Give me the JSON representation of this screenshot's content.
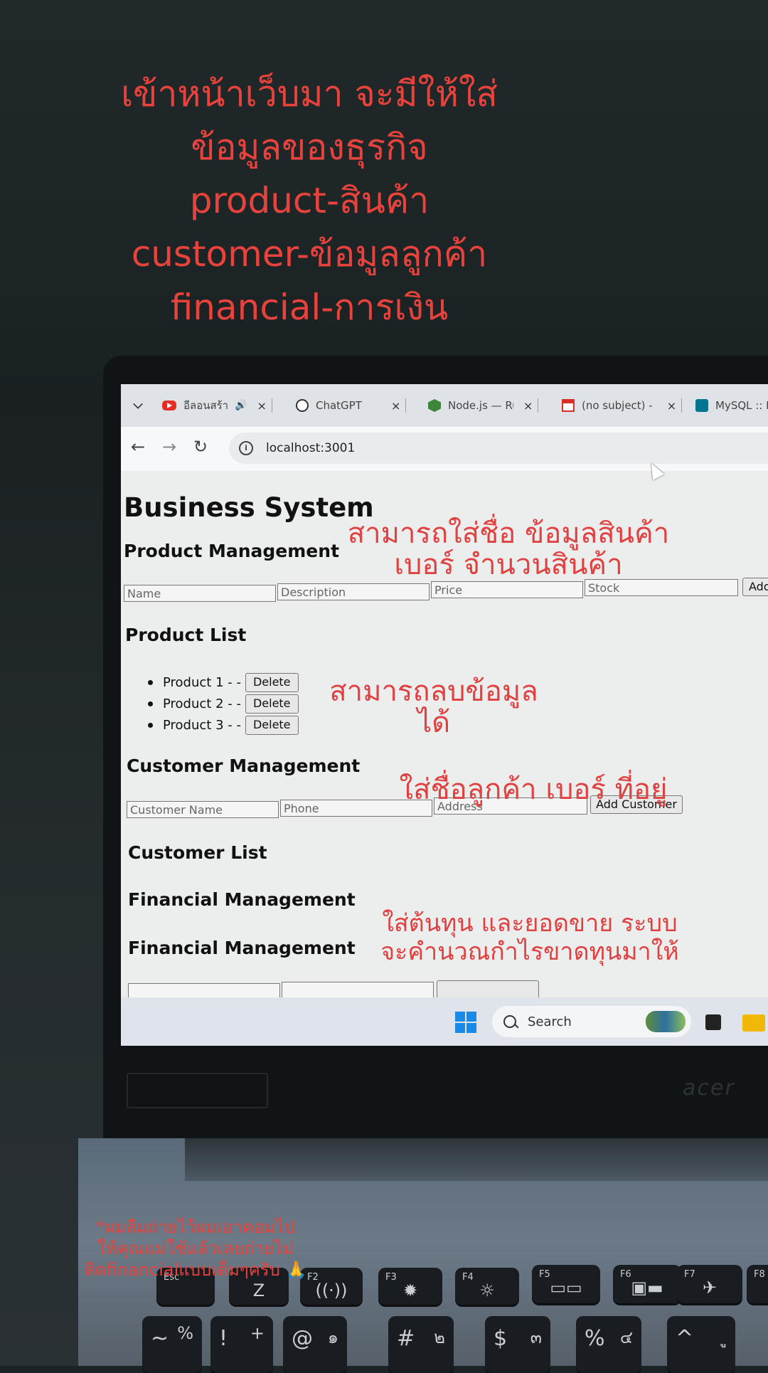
{
  "overlay": {
    "title_lines": [
      "เข้าหน้าเว็บมา จะมีให้ใส่",
      "ข้อมูลของธุรกิจ",
      "product-สินค้า",
      "customer-ข้อมูลลูกค้า",
      "financial-การเงิน"
    ],
    "note_product_line1": "สามารถใส่ชื่อ ข้อมูลสินค้า",
    "note_product_line2": "เบอร์ จำนวนสินค้า",
    "note_delete_line1": "สามารถลบข้อมูล",
    "note_delete_line2": "ได้",
    "note_customer": "ใส่ชื่อลูกค้า เบอร์ ที่อยู่",
    "note_financial_line1": "ใส่ต้นทุน และยอดขาย ระบบ",
    "note_financial_line2": "จะคำนวณกำไรขาดทุนมาให้",
    "footnote_line1": "*ผมลืมถ่ายไว้ผมเอาคอมไป",
    "footnote_line2": "ให้คุณแม่ใช้แล้วเลยถ่ายไม่",
    "footnote_line3": "ติดfinancialแบบเต็มๆครับ 🙏",
    "accent_color": "#e8423c"
  },
  "browser": {
    "tabs": [
      {
        "label": "อีลอนสร้าง",
        "favicon": "youtube-icon",
        "has_audio": true
      },
      {
        "label": "ChatGPT",
        "favicon": "chatgpt-icon"
      },
      {
        "label": "Node.js — Ru",
        "favicon": "nodejs-icon"
      },
      {
        "label": "(no subject) -",
        "favicon": "gmail-icon"
      },
      {
        "label": "MySQL :: B",
        "favicon": "mysql-icon"
      }
    ],
    "close_glyph": "×",
    "audio_glyph": "🔊",
    "url": "localhost:3001"
  },
  "page": {
    "title": "Business System",
    "product_section": "Product Management",
    "product_fields": [
      "Name",
      "Description",
      "Price",
      "Stock"
    ],
    "product_add_button": "Add",
    "product_list_title": "Product List",
    "products": [
      "Product 1 - -",
      "Product 2 - -",
      "Product 3 - -"
    ],
    "delete_label": "Delete",
    "customer_section": "Customer Management",
    "customer_fields": [
      "Customer Name",
      "Phone",
      "Address"
    ],
    "customer_add_button": "Add Customer",
    "customer_list_title": "Customer List",
    "financial_section_1": "Financial Management",
    "financial_section_2": "Financial Management"
  },
  "taskbar": {
    "search_label": "Search"
  },
  "laptop": {
    "brand": "acer",
    "keys": [
      {
        "label": "Esc"
      },
      {
        "label": "F2"
      },
      {
        "label": "F3"
      },
      {
        "label": "F4"
      },
      {
        "label": "F5"
      },
      {
        "label": "F6"
      },
      {
        "label": "F7"
      },
      {
        "label": "F8"
      }
    ],
    "number_keys": [
      {
        "top": "~",
        "side": "%"
      },
      {
        "top": "!",
        "side": "+"
      },
      {
        "top": "@",
        "side": "๑"
      },
      {
        "top": "#",
        "side": "๒"
      },
      {
        "top": "$",
        "side": "๓"
      },
      {
        "top": "%",
        "side": "๔"
      },
      {
        "top": "^",
        "side": "ู"
      }
    ]
  }
}
